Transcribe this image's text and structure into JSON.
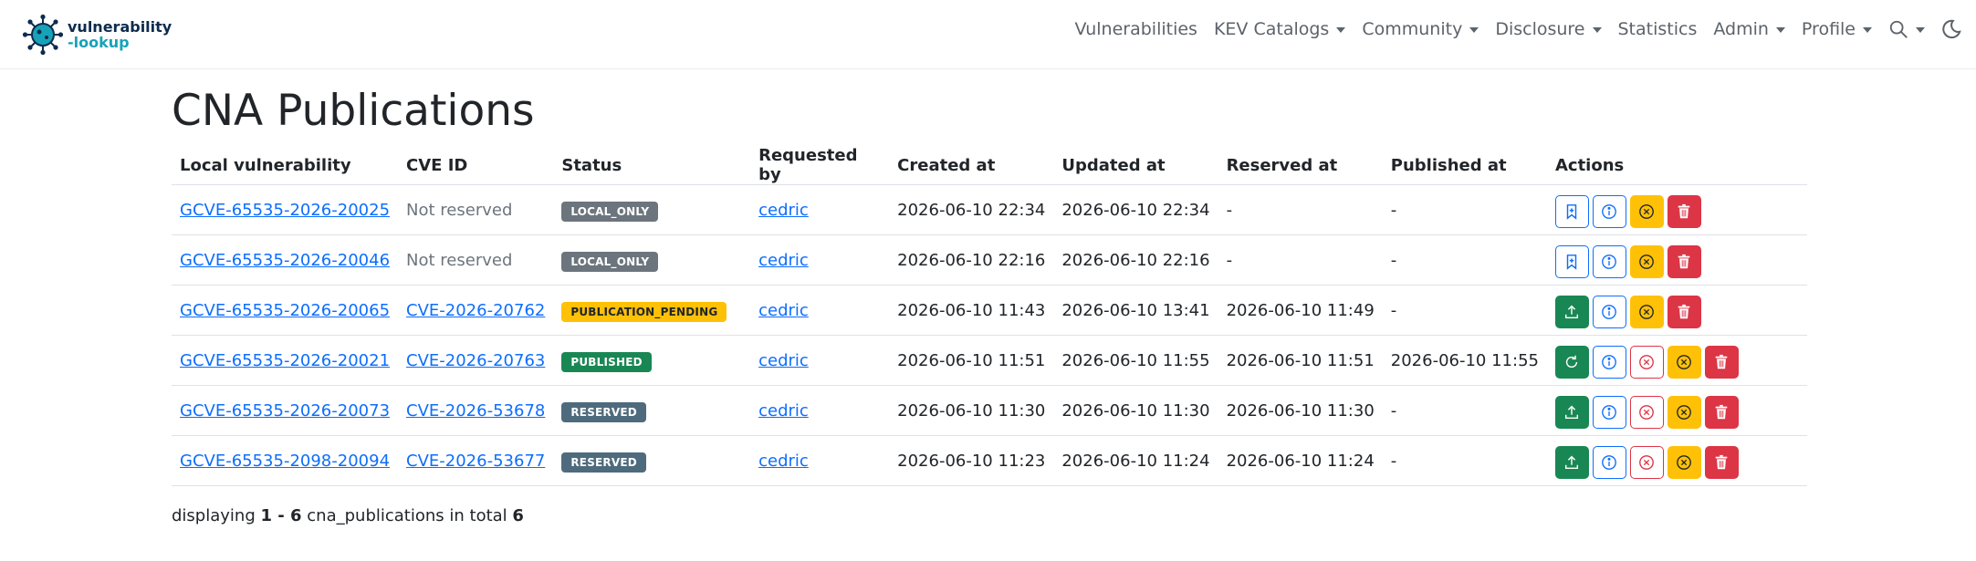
{
  "brand": {
    "line1": "vulnerability",
    "line2": "-lookup"
  },
  "nav": {
    "items": [
      {
        "label": "Vulnerabilities",
        "dropdown": false
      },
      {
        "label": "KEV Catalogs",
        "dropdown": true
      },
      {
        "label": "Community",
        "dropdown": true
      },
      {
        "label": "Disclosure",
        "dropdown": true
      },
      {
        "label": "Statistics",
        "dropdown": false
      },
      {
        "label": "Admin",
        "dropdown": true
      },
      {
        "label": "Profile",
        "dropdown": true
      }
    ],
    "search_icon": "search-icon",
    "theme_icon": "moon-icon"
  },
  "page": {
    "title": "CNA Publications"
  },
  "table": {
    "headers": [
      "Local vulnerability",
      "CVE ID",
      "Status",
      "Requested by",
      "Created at",
      "Updated at",
      "Reserved at",
      "Published at",
      "Actions"
    ],
    "rows": [
      {
        "local": "GCVE-65535-2026-20025",
        "cve": "Not reserved",
        "cve_link": false,
        "status": "LOCAL_ONLY",
        "status_class": "local_only",
        "requested_by": "cedric",
        "created": "2026-06-10 22:34",
        "updated": "2026-06-10 22:34",
        "reserved": "-",
        "published": "-",
        "actions": [
          "bookmark",
          "info",
          "cancel",
          "delete"
        ]
      },
      {
        "local": "GCVE-65535-2026-20046",
        "cve": "Not reserved",
        "cve_link": false,
        "status": "LOCAL_ONLY",
        "status_class": "local_only",
        "requested_by": "cedric",
        "created": "2026-06-10 22:16",
        "updated": "2026-06-10 22:16",
        "reserved": "-",
        "published": "-",
        "actions": [
          "bookmark",
          "info",
          "cancel",
          "delete"
        ]
      },
      {
        "local": "GCVE-65535-2026-20065",
        "cve": "CVE-2026-20762",
        "cve_link": true,
        "status": "PUBLICATION_PENDING",
        "status_class": "publication_pending",
        "requested_by": "cedric",
        "created": "2026-06-10 11:43",
        "updated": "2026-06-10 13:41",
        "reserved": "2026-06-10 11:49",
        "published": "-",
        "actions": [
          "publish",
          "info",
          "cancel",
          "delete"
        ]
      },
      {
        "local": "GCVE-65535-2026-20021",
        "cve": "CVE-2026-20763",
        "cve_link": true,
        "status": "PUBLISHED",
        "status_class": "published",
        "requested_by": "cedric",
        "created": "2026-06-10 11:51",
        "updated": "2026-06-10 11:55",
        "reserved": "2026-06-10 11:51",
        "published": "2026-06-10 11:55",
        "actions": [
          "refresh",
          "info",
          "revoke",
          "cancel",
          "delete"
        ]
      },
      {
        "local": "GCVE-65535-2026-20073",
        "cve": "CVE-2026-53678",
        "cve_link": true,
        "status": "RESERVED",
        "status_class": "reserved",
        "requested_by": "cedric",
        "created": "2026-06-10 11:30",
        "updated": "2026-06-10 11:30",
        "reserved": "2026-06-10 11:30",
        "published": "-",
        "actions": [
          "publish",
          "info",
          "revoke",
          "cancel",
          "delete"
        ]
      },
      {
        "local": "GCVE-65535-2098-20094",
        "cve": "CVE-2026-53677",
        "cve_link": true,
        "status": "RESERVED",
        "status_class": "reserved",
        "requested_by": "cedric",
        "created": "2026-06-10 11:23",
        "updated": "2026-06-10 11:24",
        "reserved": "2026-06-10 11:24",
        "published": "-",
        "actions": [
          "publish",
          "info",
          "revoke",
          "cancel",
          "delete"
        ]
      }
    ]
  },
  "footer": {
    "prefix": "displaying",
    "range": "1 - 6",
    "middle": "cna_publications in total",
    "total": "6"
  },
  "colors": {
    "primary": "#0d6efd",
    "success": "#198754",
    "warning": "#ffc107",
    "danger": "#dc3545",
    "secondary": "#6c757d"
  }
}
